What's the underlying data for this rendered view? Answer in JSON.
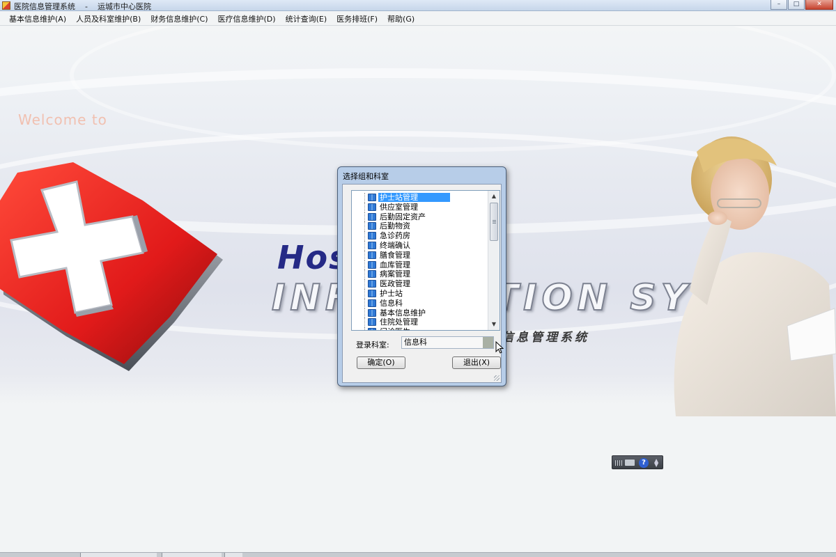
{
  "window": {
    "title": "医院信息管理系统    -    运城市中心医院",
    "controls": {
      "minimize": "–",
      "maximize": "□",
      "close": "✕"
    }
  },
  "menu": [
    "基本信息维护(A)",
    "人员及科室维护(B)",
    "财务信息维护(C)",
    "医疗信息维护(D)",
    "统计查询(E)",
    "医务排班(F)",
    "帮助(G)"
  ],
  "splash": {
    "welcome": "Welcome to",
    "hos": "Hos",
    "info_system": "INFORMATION SYSTEM",
    "cn_title": "信息管理系统"
  },
  "dialog": {
    "title": "选择组和科室",
    "tree_items": [
      "护士站管理",
      "供应室管理",
      "后勤固定资产",
      "后勤物资",
      "急诊药房",
      "终端确认",
      "膳食管理",
      "血库管理",
      "病案管理",
      "医政管理",
      "护士站",
      "信息科",
      "基本信息维护",
      "住院处管理",
      "门诊医生"
    ],
    "selected_index": 0,
    "login_label": "登录科室:",
    "login_value": "信息科",
    "ok_button": "确定(O)",
    "exit_button": "退出(X)"
  },
  "mini_toolbar": {
    "help": "?"
  },
  "colors": {
    "selection": "#3399ff",
    "dialog_frame": "#b7cde8",
    "hos_text": "#252a86",
    "cross_red": "#e11a1a"
  }
}
